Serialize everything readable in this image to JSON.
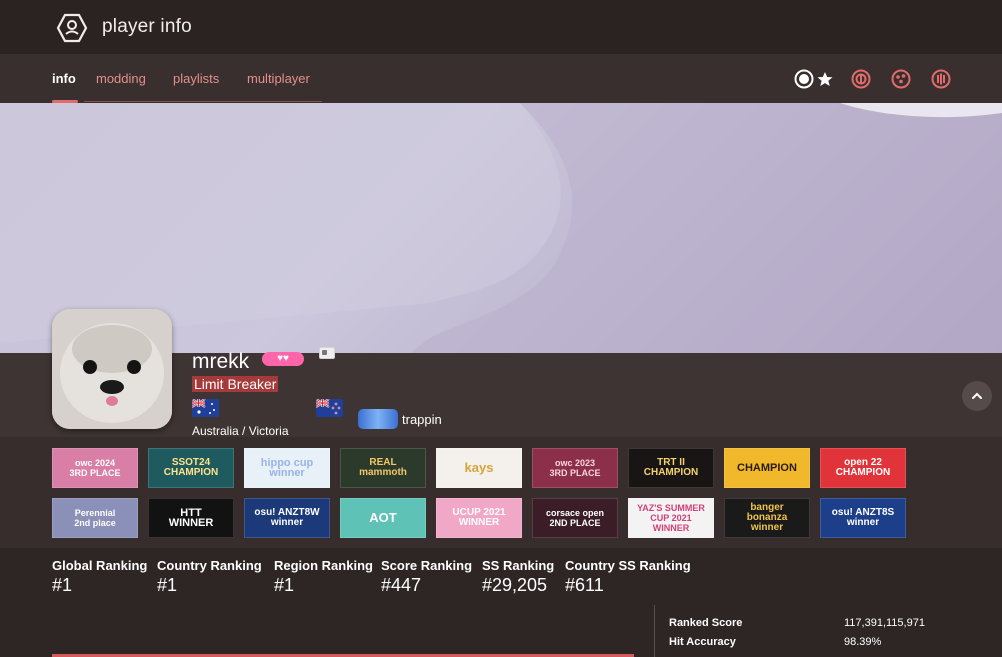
{
  "window": {
    "title": "player info",
    "logo_icon": "user-badge-icon"
  },
  "tabs": [
    {
      "label": "info",
      "active": true
    },
    {
      "label": "modding",
      "active": false
    },
    {
      "label": "playlists",
      "active": false
    },
    {
      "label": "multiplayer",
      "active": false
    }
  ],
  "modes": [
    {
      "name": "osu-standard-icon",
      "active": true
    },
    {
      "name": "default-mode-star-icon",
      "active": true
    },
    {
      "name": "osu-taiko-icon",
      "active": false
    },
    {
      "name": "osu-catch-icon",
      "active": false
    },
    {
      "name": "osu-mania-icon",
      "active": false
    }
  ],
  "profile": {
    "username": "mrekk",
    "supporter_badge": "♥♥",
    "title": "Limit Breaker",
    "location": "Australia / Victoria",
    "team": "trappin",
    "flags": [
      "australia-flag",
      "new-zealand-flag"
    ]
  },
  "badges": [
    {
      "text": "owc 2024\n3RD PLACE",
      "bg": "#d97fa7",
      "fg": "#ffffff",
      "size": 9
    },
    {
      "text": "SSOT24\nCHAMPION",
      "bg": "#1f5a5e",
      "fg": "#ffe38a",
      "size": 10
    },
    {
      "text": "hippo cup\nwinner",
      "bg": "#e8f0f8",
      "fg": "#9ab3e8",
      "size": 11
    },
    {
      "text": "REAL\nmammoth",
      "bg": "#2b3a2a",
      "fg": "#f1c86a",
      "size": 10
    },
    {
      "text": "kays",
      "bg": "#f4f1ec",
      "fg": "#d6a53a",
      "size": 13
    },
    {
      "text": "owc 2023\n3RD PLACE",
      "bg": "#8b2f4b",
      "fg": "#ffd3df",
      "size": 9
    },
    {
      "text": "TRT II\nCHAMPION",
      "bg": "#191515",
      "fg": "#f4d36b",
      "size": 10
    },
    {
      "text": "CHAMPION",
      "bg": "#f0b82a",
      "fg": "#2b1c10",
      "size": 11
    },
    {
      "text": "open 22\nCHAMPION",
      "bg": "#e0343a",
      "fg": "#ffffff",
      "size": 10
    },
    {
      "text": "Perennial\n2nd place",
      "bg": "#8a90b8",
      "fg": "#ffffff",
      "size": 9
    },
    {
      "text": "HTT\nWINNER",
      "bg": "#121212",
      "fg": "#ffffff",
      "size": 11
    },
    {
      "text": "osu! ANZT8W\nwinner",
      "bg": "#1c3a7a",
      "fg": "#ffffff",
      "size": 10
    },
    {
      "text": "AOT",
      "bg": "#5ec2b7",
      "fg": "#ffffff",
      "size": 13
    },
    {
      "text": "UCUP 2021\nWINNER",
      "bg": "#f1a8c7",
      "fg": "#ffffff",
      "size": 10
    },
    {
      "text": "corsace open\n2ND PLACE",
      "bg": "#3a1d27",
      "fg": "#ffffff",
      "size": 9
    },
    {
      "text": "YAZ'S SUMMER\nCUP 2021\nWINNER",
      "bg": "#f3f3f3",
      "fg": "#d43f7a",
      "size": 9
    },
    {
      "text": "banger\nbonanza\nwinner",
      "bg": "#1a1a1a",
      "fg": "#f0c34a",
      "size": 10
    },
    {
      "text": "osu! ANZT8S\nwinner",
      "bg": "#1d3f8a",
      "fg": "#ffffff",
      "size": 10
    }
  ],
  "rankings": [
    {
      "label": "Global Ranking",
      "value": "#1"
    },
    {
      "label": "Country Ranking",
      "value": "#1"
    },
    {
      "label": "Region Ranking",
      "value": "#1"
    },
    {
      "label": "Score Ranking",
      "value": "#447"
    },
    {
      "label": "SS Ranking",
      "value": "#29,205"
    },
    {
      "label": "Country SS Ranking",
      "value": "#611"
    }
  ],
  "stats": [
    {
      "label": "Ranked Score",
      "value": "117,391,115,971"
    },
    {
      "label": "Hit Accuracy",
      "value": "98.39%"
    }
  ],
  "colors": {
    "accent": "#e36b6b",
    "header": "#2b2322",
    "tabbar": "#382f2e"
  }
}
